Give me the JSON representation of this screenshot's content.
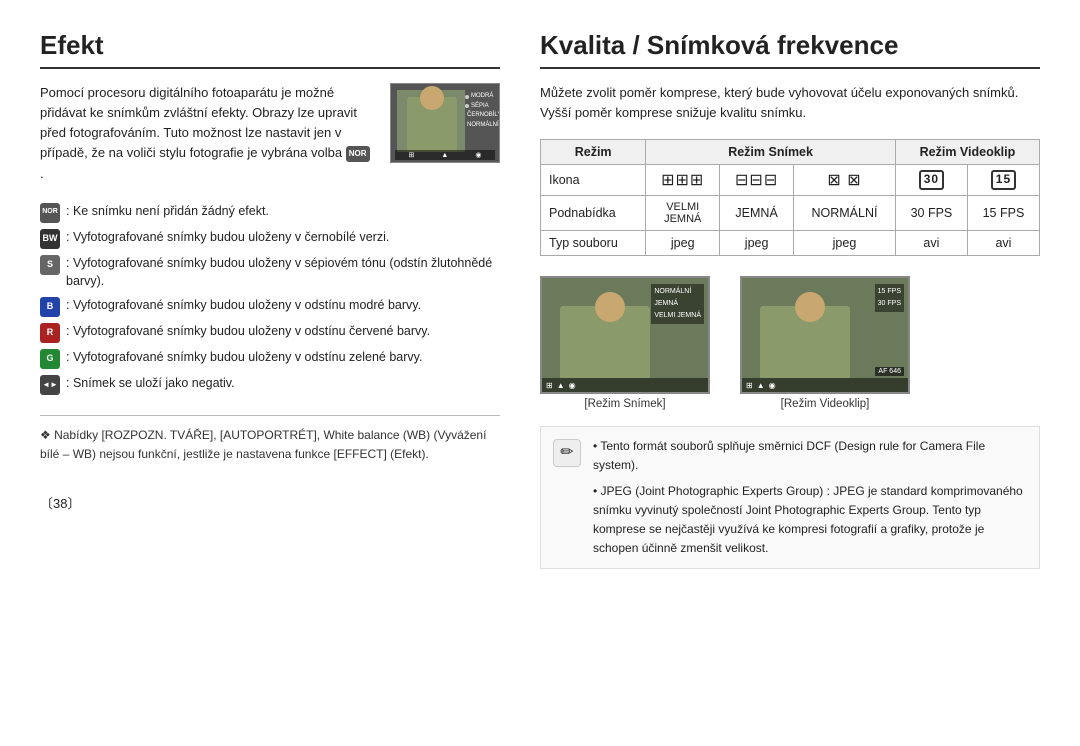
{
  "left": {
    "title": "Efekt",
    "intro": "Pomocí procesoru digitálního fotoaparátu je možné přidávat ke snímkům zvláštní efekty. Obrazy lze upravit před fotografováním. Tuto možnost lze nastavit jen v případě, že na voliči stylu fotografie je vybrána volba",
    "intro_badge": "NOR",
    "effects": [
      {
        "badge": "NOR",
        "badge_type": "nor",
        "text": ": Ke snímku není přidán žádný efekt."
      },
      {
        "badge": "BW",
        "badge_type": "bw",
        "text": ": Vyfotografované snímky budou uloženy v černobílé verzi."
      },
      {
        "badge": "S",
        "badge_type": "s",
        "text": ": Vyfotografované snímky budou uloženy v sépiovém tónu (odstín žlutohnědé barvy)."
      },
      {
        "badge": "B",
        "badge_type": "b",
        "text": ": Vyfotografované snímky budou uloženy v odstínu modré barvy."
      },
      {
        "badge": "R",
        "badge_type": "r",
        "text": ": Vyfotografované snímky budou uloženy v odstínu červené barvy."
      },
      {
        "badge": "G",
        "badge_type": "g",
        "text": ": Vyfotografované snímky budou uloženy v odstínu zelené barvy."
      },
      {
        "badge": "◄►",
        "badge_type": "neg",
        "text": ": Snímek se uložní jako negativ."
      }
    ],
    "note_symbol": "❖",
    "note_text": "Nabídky [ROZPOZN. TVÁŘE], [AUTOPORTRÉT], White balance (WB) (Vyvážení bílé – WB) nejsou funkční, jestliže je nastavena funkce [EFFECT] (Efekt).",
    "page_number": "〔38〕"
  },
  "right": {
    "title": "Kvalita / Snímková frekvence",
    "intro": "Můžete zvolit poměr komprese, který bude vyhovovat účelu exponovaných snímků. Vyšší poměr komprese snižuje kvalitu snímku.",
    "table": {
      "headers": [
        "Režim",
        "Režim Snímek",
        "Režim Videoklip"
      ],
      "row_icon_label": "Ikona",
      "row_sub_label": "Podnabídka",
      "row_file_label": "Typ souboru",
      "cols": [
        {
          "icon": "⊞⊞⊞",
          "sub": "VELMI\nJEMNÁ",
          "file": "jpeg"
        },
        {
          "icon": "⊟⊟⊟",
          "sub": "JEMNÁ",
          "file": "jpeg"
        },
        {
          "icon": "⊠ ⊠",
          "sub": "NORMÁLNÍ",
          "file": "jpeg"
        },
        {
          "icon": "30",
          "sub": "30 FPS",
          "file": "avi",
          "num": true
        },
        {
          "icon": "15",
          "sub": "15 FPS",
          "file": "avi",
          "num": true
        }
      ]
    },
    "thumb_left_label": "[Režim Snímek]",
    "thumb_right_label": "[Režim Videoklip]",
    "thumb_left_menu": [
      "NORMÁLNÍ",
      "JEMNÁ",
      "VELMI JEMNÁ"
    ],
    "thumb_right_menu": [
      "15 FPS",
      "30 FPS"
    ],
    "notes": [
      "Tento formát souborů splňuje směrnici DCF (Design rule for Camera File system).",
      "JPEG (Joint Photographic Experts Group) : JPEG je standard komprimovaného snímku vyvinutý společností Joint Photographic Experts Group. Tento typ komprese se nejčastěji využívá ke kompresi fotografií a grafiky, protože je schopen účinně zmenšit velikost."
    ]
  }
}
